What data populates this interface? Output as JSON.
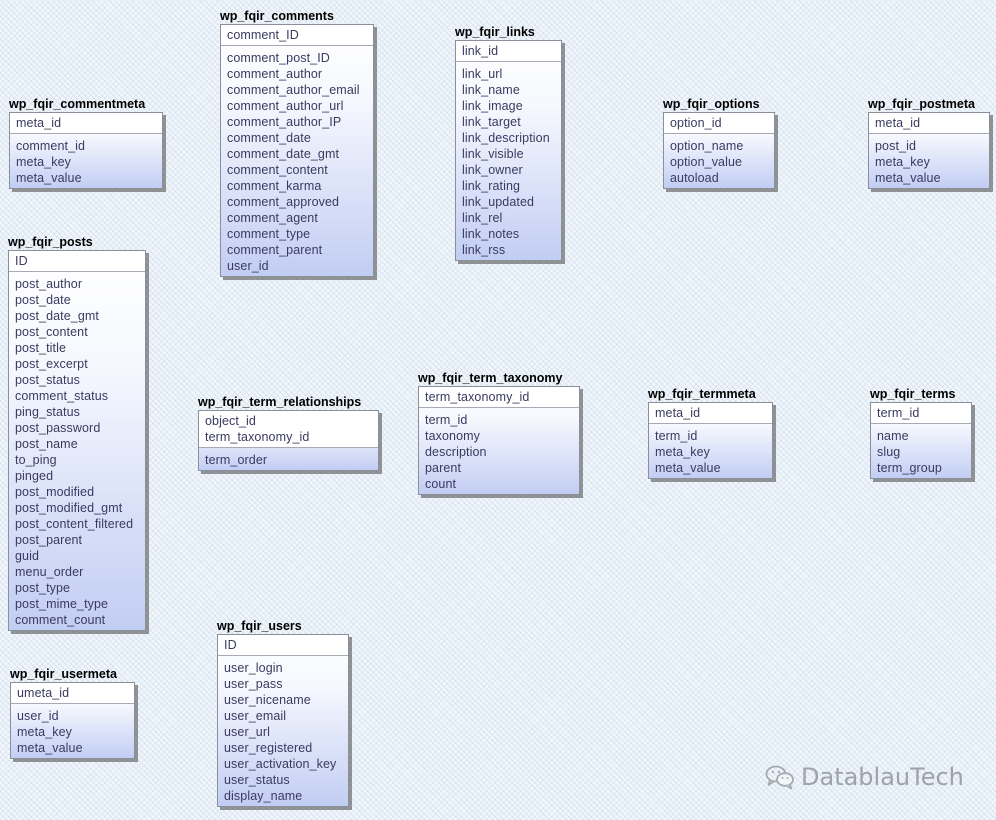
{
  "tables": [
    {
      "name": "wp_fqir_comments",
      "keys": [
        "comment_ID"
      ],
      "attributes": [
        "comment_post_ID",
        "comment_author",
        "comment_author_email",
        "comment_author_url",
        "comment_author_IP",
        "comment_date",
        "comment_date_gmt",
        "comment_content",
        "comment_karma",
        "comment_approved",
        "comment_agent",
        "comment_type",
        "comment_parent",
        "user_id"
      ]
    },
    {
      "name": "wp_fqir_links",
      "keys": [
        "link_id"
      ],
      "attributes": [
        "link_url",
        "link_name",
        "link_image",
        "link_target",
        "link_description",
        "link_visible",
        "link_owner",
        "link_rating",
        "link_updated",
        "link_rel",
        "link_notes",
        "link_rss"
      ]
    },
    {
      "name": "wp_fqir_commentmeta",
      "keys": [
        "meta_id"
      ],
      "attributes": [
        "comment_id",
        "meta_key",
        "meta_value"
      ]
    },
    {
      "name": "wp_fqir_options",
      "keys": [
        "option_id"
      ],
      "attributes": [
        "option_name",
        "option_value",
        "autoload"
      ]
    },
    {
      "name": "wp_fqir_postmeta",
      "keys": [
        "meta_id"
      ],
      "attributes": [
        "post_id",
        "meta_key",
        "meta_value"
      ]
    },
    {
      "name": "wp_fqir_posts",
      "keys": [
        "ID"
      ],
      "attributes": [
        "post_author",
        "post_date",
        "post_date_gmt",
        "post_content",
        "post_title",
        "post_excerpt",
        "post_status",
        "comment_status",
        "ping_status",
        "post_password",
        "post_name",
        "to_ping",
        "pinged",
        "post_modified",
        "post_modified_gmt",
        "post_content_filtered",
        "post_parent",
        "guid",
        "menu_order",
        "post_type",
        "post_mime_type",
        "comment_count"
      ]
    },
    {
      "name": "wp_fqir_term_relationships",
      "keys": [
        "object_id",
        "term_taxonomy_id"
      ],
      "attributes": [
        "term_order"
      ]
    },
    {
      "name": "wp_fqir_term_taxonomy",
      "keys": [
        "term_taxonomy_id"
      ],
      "attributes": [
        "term_id",
        "taxonomy",
        "description",
        "parent",
        "count"
      ]
    },
    {
      "name": "wp_fqir_termmeta",
      "keys": [
        "meta_id"
      ],
      "attributes": [
        "term_id",
        "meta_key",
        "meta_value"
      ]
    },
    {
      "name": "wp_fqir_terms",
      "keys": [
        "term_id"
      ],
      "attributes": [
        "name",
        "slug",
        "term_group"
      ]
    },
    {
      "name": "wp_fqir_users",
      "keys": [
        "ID"
      ],
      "attributes": [
        "user_login",
        "user_pass",
        "user_nicename",
        "user_email",
        "user_url",
        "user_registered",
        "user_activation_key",
        "user_status",
        "display_name"
      ]
    },
    {
      "name": "wp_fqir_usermeta",
      "keys": [
        "umeta_id"
      ],
      "attributes": [
        "user_id",
        "meta_key",
        "meta_value"
      ]
    }
  ],
  "watermark": {
    "text": "DatablauTech",
    "icon": "wechat-icon"
  }
}
